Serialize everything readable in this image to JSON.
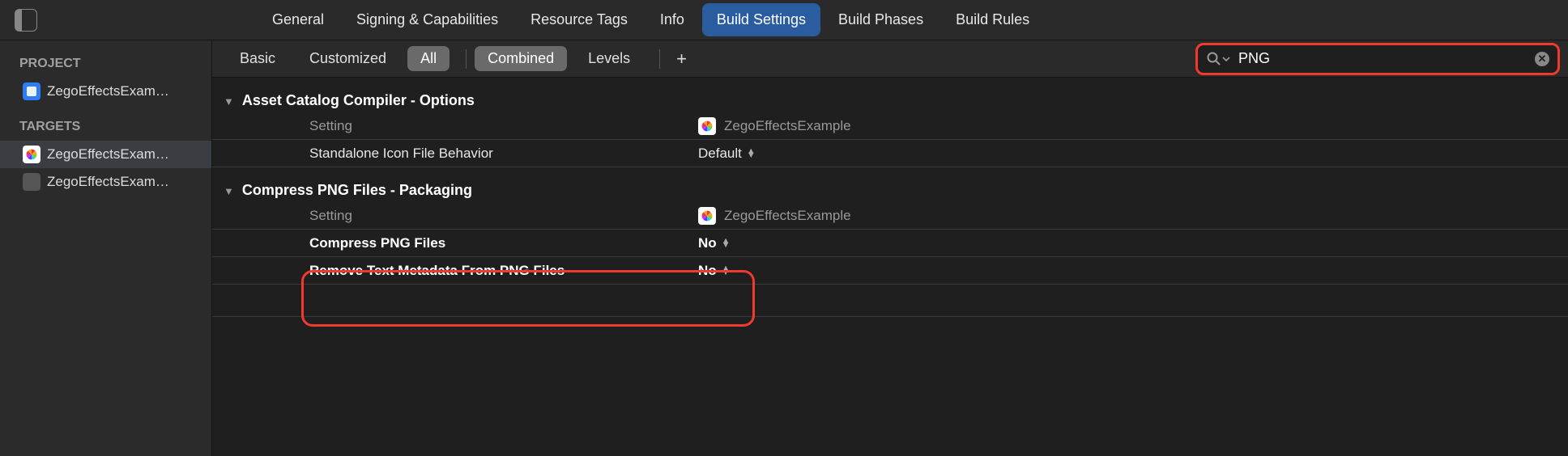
{
  "top_tabs": {
    "items": [
      "General",
      "Signing & Capabilities",
      "Resource Tags",
      "Info",
      "Build Settings",
      "Build Phases",
      "Build Rules"
    ],
    "active_index": 4
  },
  "sidebar": {
    "project_header": "PROJECT",
    "project_item": "ZegoEffectsExam…",
    "targets_header": "TARGETS",
    "target_items": [
      "ZegoEffectsExam…",
      "ZegoEffectsExam…"
    ],
    "selected_target_index": 0
  },
  "filter": {
    "basic": "Basic",
    "customized": "Customized",
    "all": "All",
    "combined": "Combined",
    "levels": "Levels"
  },
  "search": {
    "value": "PNG"
  },
  "sections": [
    {
      "title": "Asset Catalog Compiler - Options",
      "column_setting_label": "Setting",
      "column_value_label": "ZegoEffectsExample",
      "rows": [
        {
          "setting": "Standalone Icon File Behavior",
          "value": "Default",
          "bold": false
        }
      ]
    },
    {
      "title": "Compress PNG Files - Packaging",
      "column_setting_label": "Setting",
      "column_value_label": "ZegoEffectsExample",
      "rows": [
        {
          "setting": "Compress PNG Files",
          "value": "No",
          "bold": true
        },
        {
          "setting": "Remove Text Metadata From PNG Files",
          "value": "No",
          "bold": true
        }
      ]
    }
  ]
}
